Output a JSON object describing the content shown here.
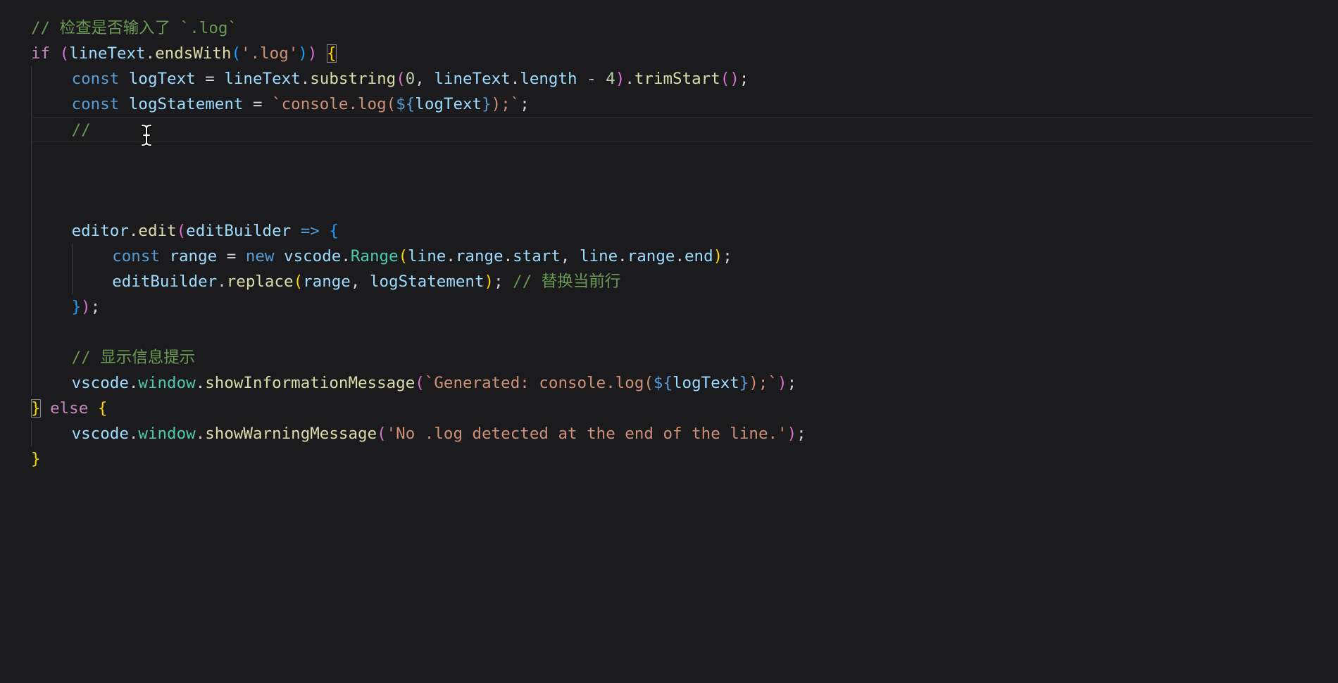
{
  "editor": {
    "language": "javascript",
    "cursor_line": 5,
    "lines": [
      {
        "indent": 0,
        "tokens": [
          {
            "t": "// 检查是否输入了 `.log`",
            "c": "comment"
          }
        ]
      },
      {
        "indent": 0,
        "tokens": [
          {
            "t": "if",
            "c": "keyword"
          },
          {
            "t": " ",
            "c": "punct"
          },
          {
            "t": "(",
            "c": "b2"
          },
          {
            "t": "lineText",
            "c": "var"
          },
          {
            "t": ".",
            "c": "punct"
          },
          {
            "t": "endsWith",
            "c": "func"
          },
          {
            "t": "(",
            "c": "b3"
          },
          {
            "t": "'.log'",
            "c": "string"
          },
          {
            "t": ")",
            "c": "b3"
          },
          {
            "t": ")",
            "c": "b2"
          },
          {
            "t": " ",
            "c": "punct"
          },
          {
            "t": "{",
            "c": "b1",
            "match": true
          }
        ]
      },
      {
        "indent": 1,
        "tokens": [
          {
            "t": "const",
            "c": "storage"
          },
          {
            "t": " ",
            "c": "punct"
          },
          {
            "t": "logText",
            "c": "var"
          },
          {
            "t": " = ",
            "c": "punct"
          },
          {
            "t": "lineText",
            "c": "var"
          },
          {
            "t": ".",
            "c": "punct"
          },
          {
            "t": "substring",
            "c": "func"
          },
          {
            "t": "(",
            "c": "b2"
          },
          {
            "t": "0",
            "c": "number"
          },
          {
            "t": ", ",
            "c": "punct"
          },
          {
            "t": "lineText",
            "c": "var"
          },
          {
            "t": ".",
            "c": "punct"
          },
          {
            "t": "length",
            "c": "var"
          },
          {
            "t": " - ",
            "c": "punct"
          },
          {
            "t": "4",
            "c": "number"
          },
          {
            "t": ")",
            "c": "b2"
          },
          {
            "t": ".",
            "c": "punct"
          },
          {
            "t": "trimStart",
            "c": "func"
          },
          {
            "t": "(",
            "c": "b2"
          },
          {
            "t": ")",
            "c": "b2"
          },
          {
            "t": ";",
            "c": "punct"
          }
        ]
      },
      {
        "indent": 1,
        "tokens": [
          {
            "t": "const",
            "c": "storage"
          },
          {
            "t": " ",
            "c": "punct"
          },
          {
            "t": "logStatement",
            "c": "var"
          },
          {
            "t": " = ",
            "c": "punct"
          },
          {
            "t": "`console.log(",
            "c": "string"
          },
          {
            "t": "${",
            "c": "interp"
          },
          {
            "t": "logText",
            "c": "var"
          },
          {
            "t": "}",
            "c": "interp"
          },
          {
            "t": ");`",
            "c": "string"
          },
          {
            "t": ";",
            "c": "punct"
          }
        ]
      },
      {
        "indent": 1,
        "tokens": [
          {
            "t": "//",
            "c": "comment"
          }
        ]
      },
      {
        "indent": 1,
        "tokens": []
      },
      {
        "indent": 1,
        "tokens": []
      },
      {
        "indent": 1,
        "tokens": []
      },
      {
        "indent": 1,
        "tokens": [
          {
            "t": "editor",
            "c": "var"
          },
          {
            "t": ".",
            "c": "punct"
          },
          {
            "t": "edit",
            "c": "func"
          },
          {
            "t": "(",
            "c": "b2"
          },
          {
            "t": "editBuilder",
            "c": "var"
          },
          {
            "t": " ",
            "c": "punct"
          },
          {
            "t": "=>",
            "c": "storage"
          },
          {
            "t": " ",
            "c": "punct"
          },
          {
            "t": "{",
            "c": "b3"
          }
        ]
      },
      {
        "indent": 2,
        "tokens": [
          {
            "t": "const",
            "c": "storage"
          },
          {
            "t": " ",
            "c": "punct"
          },
          {
            "t": "range",
            "c": "var"
          },
          {
            "t": " = ",
            "c": "punct"
          },
          {
            "t": "new",
            "c": "storage"
          },
          {
            "t": " ",
            "c": "punct"
          },
          {
            "t": "vscode",
            "c": "var"
          },
          {
            "t": ".",
            "c": "punct"
          },
          {
            "t": "Range",
            "c": "type"
          },
          {
            "t": "(",
            "c": "b1"
          },
          {
            "t": "line",
            "c": "var"
          },
          {
            "t": ".",
            "c": "punct"
          },
          {
            "t": "range",
            "c": "var"
          },
          {
            "t": ".",
            "c": "punct"
          },
          {
            "t": "start",
            "c": "var"
          },
          {
            "t": ", ",
            "c": "punct"
          },
          {
            "t": "line",
            "c": "var"
          },
          {
            "t": ".",
            "c": "punct"
          },
          {
            "t": "range",
            "c": "var"
          },
          {
            "t": ".",
            "c": "punct"
          },
          {
            "t": "end",
            "c": "var"
          },
          {
            "t": ")",
            "c": "b1"
          },
          {
            "t": ";",
            "c": "punct"
          }
        ]
      },
      {
        "indent": 2,
        "tokens": [
          {
            "t": "editBuilder",
            "c": "var"
          },
          {
            "t": ".",
            "c": "punct"
          },
          {
            "t": "replace",
            "c": "func"
          },
          {
            "t": "(",
            "c": "b1"
          },
          {
            "t": "range",
            "c": "var"
          },
          {
            "t": ", ",
            "c": "punct"
          },
          {
            "t": "logStatement",
            "c": "var"
          },
          {
            "t": ")",
            "c": "b1"
          },
          {
            "t": "; ",
            "c": "punct"
          },
          {
            "t": "// 替换当前行",
            "c": "comment"
          }
        ]
      },
      {
        "indent": 1,
        "tokens": [
          {
            "t": "}",
            "c": "b3"
          },
          {
            "t": ")",
            "c": "b2"
          },
          {
            "t": ";",
            "c": "punct"
          }
        ]
      },
      {
        "indent": 1,
        "tokens": []
      },
      {
        "indent": 1,
        "tokens": [
          {
            "t": "// 显示信息提示",
            "c": "comment"
          }
        ]
      },
      {
        "indent": 1,
        "tokens": [
          {
            "t": "vscode",
            "c": "var"
          },
          {
            "t": ".",
            "c": "punct"
          },
          {
            "t": "window",
            "c": "type"
          },
          {
            "t": ".",
            "c": "punct"
          },
          {
            "t": "showInformationMessage",
            "c": "func"
          },
          {
            "t": "(",
            "c": "b2"
          },
          {
            "t": "`Generated: console.log(",
            "c": "string"
          },
          {
            "t": "${",
            "c": "interp"
          },
          {
            "t": "logText",
            "c": "var"
          },
          {
            "t": "}",
            "c": "interp"
          },
          {
            "t": ");`",
            "c": "string"
          },
          {
            "t": ")",
            "c": "b2"
          },
          {
            "t": ";",
            "c": "punct"
          }
        ]
      },
      {
        "indent": 0,
        "tokens": [
          {
            "t": "}",
            "c": "b1",
            "match": true
          },
          {
            "t": " ",
            "c": "punct"
          },
          {
            "t": "else",
            "c": "keyword"
          },
          {
            "t": " ",
            "c": "punct"
          },
          {
            "t": "{",
            "c": "b1"
          }
        ]
      },
      {
        "indent": 1,
        "tokens": [
          {
            "t": "vscode",
            "c": "var"
          },
          {
            "t": ".",
            "c": "punct"
          },
          {
            "t": "window",
            "c": "type"
          },
          {
            "t": ".",
            "c": "punct"
          },
          {
            "t": "showWarningMessage",
            "c": "func"
          },
          {
            "t": "(",
            "c": "b2"
          },
          {
            "t": "'No .log detected at the end of the line.'",
            "c": "string"
          },
          {
            "t": ")",
            "c": "b2"
          },
          {
            "t": ";",
            "c": "punct"
          }
        ]
      },
      {
        "indent": 0,
        "tokens": [
          {
            "t": "}",
            "c": "b1"
          }
        ]
      }
    ]
  },
  "theme": {
    "background": "#1b1b1d",
    "comment": "#6a9955",
    "keyword": "#c586c0",
    "storage": "#569cd6",
    "variable": "#9cdcfe",
    "function": "#dcdcaa",
    "type": "#4ec9b0",
    "string": "#ce9178",
    "number": "#b5cea8",
    "bracket_level_1": "#ffd700",
    "bracket_level_2": "#da70d6",
    "bracket_level_3": "#179fff"
  },
  "cursor": {
    "icon": "ibeam-cursor-icon"
  }
}
